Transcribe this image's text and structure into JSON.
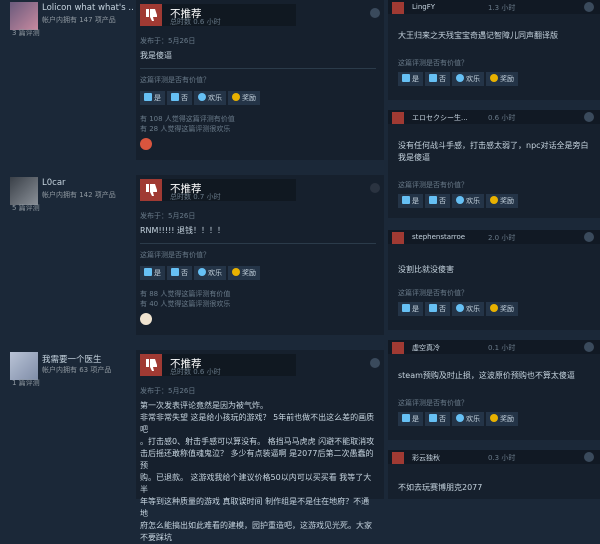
{
  "left_reviews": [
    {
      "reviewer_name": "Lolicon what what's ...",
      "owned": "帐户内拥有 147 项产品",
      "review_count": "3 篇评测",
      "verdict": "不推荐",
      "hours": "总时数 0.6 小时",
      "posted": "发布于：5月26日",
      "text": "我是傻逼",
      "helpful_question": "这篇评测是否有价值？",
      "buttons": {
        "yes": "是",
        "no": "否",
        "funny": "欢乐",
        "award": "奖励"
      },
      "stats": [
        "有 108 人觉得这篇评测有价值",
        "有 28 人觉得这篇评测很欢乐"
      ]
    },
    {
      "reviewer_name": "L0car",
      "owned": "帐户内拥有 142 项产品",
      "review_count": "5 篇评测",
      "verdict": "不推荐",
      "hours": "总时数 0.7 小时",
      "posted": "发布于：5月26日",
      "text": "RNM!!!!! 退钱！！！！",
      "helpful_question": "这篇评测是否有价值？",
      "buttons": {
        "yes": "是",
        "no": "否",
        "funny": "欢乐",
        "award": "奖励"
      },
      "stats": [
        "有 88 人觉得这篇评测有价值",
        "有 40 人觉得这篇评测很欢乐"
      ]
    },
    {
      "reviewer_name": "我需要一个医生",
      "owned": "帐户内拥有 63 项产品",
      "review_count": "1 篇评测",
      "verdict": "不推荐",
      "hours": "总时数 0.6 小时",
      "posted": "发布于：5月26日",
      "text_lines": [
        "第一次发表评论竟然是因为被气炸。",
        "非常非常失望 这是给小孩玩的游戏？ 5年前也做不出这么差的画质吧",
        "。打击感0、射击手感可以算没有。 格挡马马虎虎 闪避不能取消攻",
        "击后摇还敢称值魂鬼泣？ 多少有点装逼啊 是2077后第二次愚蠢的预",
        "购。已退款。 这游戏我给个建议价格50以内可以买买看 我等了大半",
        "年等到这种质量的游戏 真取误时间 制作组是不是住在地府？不通地",
        "府怎么能搞出如此难看的建模，园护重造吧，这游戏见光死。大家",
        "不要踩坑"
      ]
    }
  ],
  "right_reviews": [
    {
      "name": "LingFY",
      "hours": "1.3 小时",
      "text": "大王归来之天残宝宝奇遇记智障儿同声翻译版",
      "question": "这篇评测是否有价值？"
    },
    {
      "name": "エロセクシー生...",
      "hours": "0.6 小时",
      "text": "没有任何战斗手感，打击感太弱了，npc对话全是旁白我是傻逼",
      "question": "这篇评测是否有价值？"
    },
    {
      "name": "stephenstarroe",
      "hours": "2.0 小时",
      "text": "没割比就没傻害",
      "question": "这篇评测是否有价值？"
    },
    {
      "name": "虚空真冷",
      "hours": "0.1 小时",
      "text": "steam预购及时止损，这波原价预购也不算太傻逼",
      "question": "这篇评测是否有价值？"
    },
    {
      "name": "彩云独秋",
      "hours": "0.3 小时",
      "text": "不如去玩赛博朋克2077",
      "question": ""
    }
  ],
  "buttons": {
    "yes": "是",
    "no": "否",
    "funny": "欢乐",
    "award": "奖励"
  },
  "colors": {
    "background": "#1b2838",
    "card": "#16202d",
    "thumbs_down": "#a03a33",
    "accent": "#66c0f4"
  }
}
